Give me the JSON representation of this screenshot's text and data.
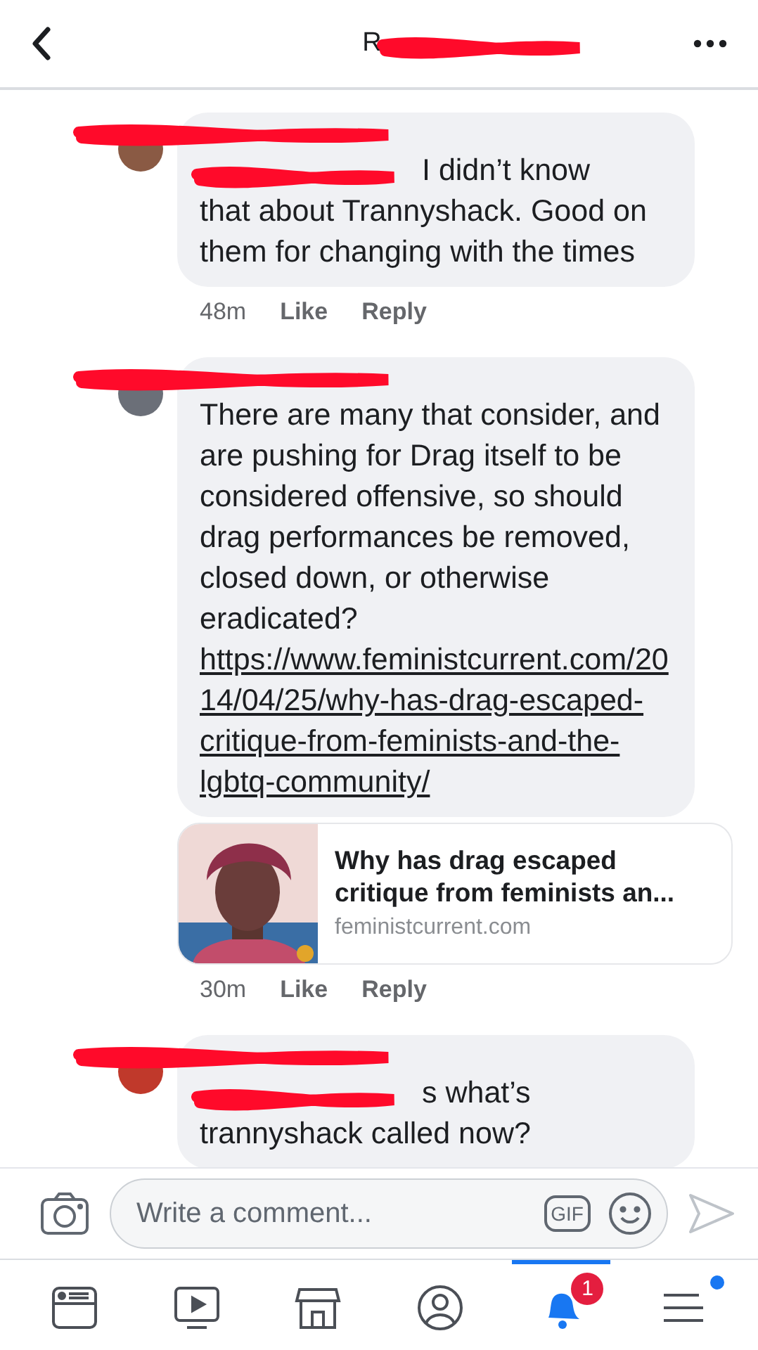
{
  "header": {
    "title": "R",
    "title_redacted": true
  },
  "comments": [
    {
      "kind": "text",
      "author_redacted": true,
      "mention_redacted": true,
      "lead": "I didn’t know",
      "text": "that about Trannyshack. Good on them for changing with the times",
      "meta": {
        "time": "48m",
        "like": "Like",
        "reply": "Reply"
      }
    },
    {
      "kind": "link",
      "author_redacted": true,
      "text": "There are many that consider, and are pushing for Drag itself to be considered offensive, so should drag performances be removed, closed down, or otherwise eradicated?",
      "link": "https://www.feministcurrent.com/2014/04/25/why-has-drag-escaped-critique-from-feminists-and-the-lgbtq-community/",
      "preview": {
        "kind": "picture",
        "title": "Why has drag escaped critique from feminists an...",
        "domain": "feministcurrent.com"
      },
      "meta": {
        "time": "30m",
        "like": "Like",
        "reply": "Reply"
      }
    },
    {
      "kind": "text",
      "author_redacted": true,
      "mention_redacted": true,
      "lead": "s what’s",
      "text": "trannyshack called now?"
    }
  ],
  "composer": {
    "placeholder": "Write a comment...",
    "gif": "GIF"
  },
  "nav": [
    {
      "kind": "feed",
      "selected": false
    },
    {
      "kind": "video",
      "selected": false
    },
    {
      "kind": "shop",
      "selected": false
    },
    {
      "kind": "profile",
      "selected": false
    },
    {
      "kind": "bell",
      "selected": true,
      "badge": "1"
    },
    {
      "kind": "menu",
      "selected": false,
      "dot": true
    }
  ]
}
